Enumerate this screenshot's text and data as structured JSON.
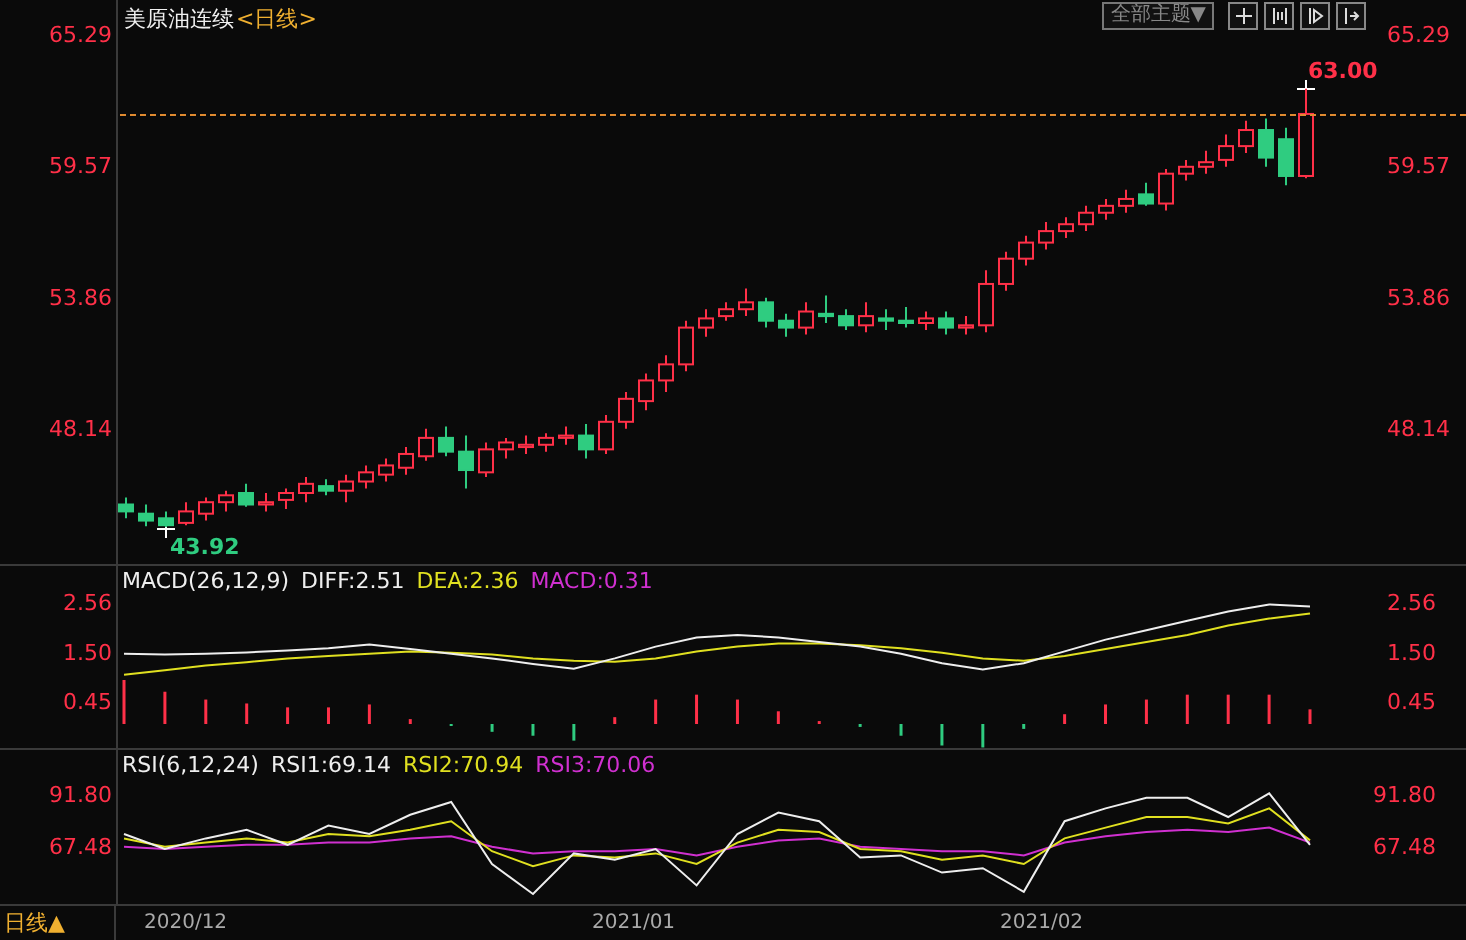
{
  "header": {
    "title": "美原油连续",
    "period_tag": "<日线>",
    "theme_button": "全部主题▼"
  },
  "price_panel": {
    "high_label": "63.00",
    "low_label": "43.92",
    "right_ticks": [
      "65.29",
      "59.57",
      "53.86",
      "48.14"
    ],
    "chart_data": {
      "type": "candlestick",
      "categories": [
        null,
        null,
        null,
        null,
        null,
        null,
        null,
        null,
        null,
        null,
        null,
        null,
        null,
        null,
        null,
        null,
        null,
        null,
        null,
        null,
        null,
        null,
        null,
        null,
        null,
        null,
        null,
        null,
        null,
        null,
        null,
        null,
        null,
        null,
        null,
        null,
        null,
        null,
        null,
        null,
        null,
        null,
        null,
        null,
        null,
        null,
        null,
        null,
        null,
        null,
        null,
        null,
        null,
        null,
        null,
        null,
        null,
        null,
        null,
        null
      ],
      "ylim": [
        42.31,
        66.86
      ],
      "yticks": [
        {
          "value": 65.29,
          "label": "65.29"
        },
        {
          "value": 59.57,
          "label": "59.57"
        },
        {
          "value": 53.86,
          "label": "53.86"
        },
        {
          "value": 48.14,
          "label": "48.14"
        }
      ],
      "ohlc": [
        [
          44.9,
          45.2,
          44.3,
          44.6
        ],
        [
          44.5,
          44.9,
          43.95,
          44.2
        ],
        [
          44.3,
          44.6,
          43.92,
          44.0
        ],
        [
          44.1,
          45.0,
          44.0,
          44.6
        ],
        [
          44.5,
          45.2,
          44.2,
          45.0
        ],
        [
          45.0,
          45.5,
          44.6,
          45.3
        ],
        [
          45.4,
          45.8,
          44.8,
          44.9
        ],
        [
          44.9,
          45.4,
          44.6,
          45.0
        ],
        [
          45.1,
          45.6,
          44.7,
          45.4
        ],
        [
          45.4,
          46.1,
          45.0,
          45.8
        ],
        [
          45.7,
          46.0,
          45.3,
          45.5
        ],
        [
          45.5,
          46.2,
          45.0,
          45.9
        ],
        [
          45.9,
          46.6,
          45.6,
          46.3
        ],
        [
          46.2,
          46.9,
          45.9,
          46.6
        ],
        [
          46.5,
          47.4,
          46.2,
          47.1
        ],
        [
          47.0,
          48.2,
          46.8,
          47.8
        ],
        [
          47.8,
          48.3,
          47.0,
          47.2
        ],
        [
          47.2,
          47.9,
          45.6,
          46.4
        ],
        [
          46.3,
          47.6,
          46.1,
          47.3
        ],
        [
          47.3,
          47.8,
          46.9,
          47.6
        ],
        [
          47.4,
          47.9,
          47.1,
          47.5
        ],
        [
          47.5,
          48.0,
          47.2,
          47.8
        ],
        [
          47.8,
          48.3,
          47.5,
          47.9
        ],
        [
          47.9,
          48.4,
          46.9,
          47.3
        ],
        [
          47.3,
          48.8,
          47.1,
          48.5
        ],
        [
          48.5,
          49.8,
          48.2,
          49.5
        ],
        [
          49.4,
          50.6,
          49.0,
          50.3
        ],
        [
          50.3,
          51.4,
          49.8,
          51.0
        ],
        [
          51.0,
          52.9,
          50.7,
          52.6
        ],
        [
          52.6,
          53.4,
          52.2,
          53.0
        ],
        [
          53.1,
          53.7,
          52.9,
          53.4
        ],
        [
          53.4,
          54.3,
          53.1,
          53.7
        ],
        [
          53.7,
          53.9,
          52.6,
          52.9
        ],
        [
          52.9,
          53.2,
          52.2,
          52.6
        ],
        [
          52.6,
          53.7,
          52.3,
          53.3
        ],
        [
          53.2,
          54.0,
          52.8,
          53.1
        ],
        [
          53.1,
          53.4,
          52.5,
          52.7
        ],
        [
          52.7,
          53.7,
          52.4,
          53.1
        ],
        [
          53.0,
          53.4,
          52.5,
          52.9
        ],
        [
          52.9,
          53.5,
          52.6,
          52.8
        ],
        [
          52.8,
          53.3,
          52.5,
          53.0
        ],
        [
          53.0,
          53.3,
          52.3,
          52.6
        ],
        [
          52.6,
          53.1,
          52.3,
          52.7
        ],
        [
          52.7,
          55.1,
          52.4,
          54.5
        ],
        [
          54.5,
          55.9,
          54.2,
          55.6
        ],
        [
          55.6,
          56.6,
          55.3,
          56.3
        ],
        [
          56.3,
          57.2,
          56.0,
          56.8
        ],
        [
          56.8,
          57.4,
          56.5,
          57.1
        ],
        [
          57.1,
          57.9,
          56.8,
          57.6
        ],
        [
          57.6,
          58.2,
          57.3,
          57.9
        ],
        [
          57.9,
          58.6,
          57.6,
          58.2
        ],
        [
          58.4,
          58.9,
          57.9,
          58.0
        ],
        [
          58.0,
          59.5,
          57.7,
          59.3
        ],
        [
          59.3,
          59.9,
          59.0,
          59.6
        ],
        [
          59.6,
          60.3,
          59.3,
          59.8
        ],
        [
          59.9,
          61.0,
          59.6,
          60.5
        ],
        [
          60.5,
          61.6,
          60.2,
          61.2
        ],
        [
          61.2,
          61.7,
          59.6,
          60.0
        ],
        [
          60.8,
          61.3,
          58.8,
          59.2
        ],
        [
          59.2,
          63.0,
          59.1,
          61.9
        ]
      ]
    }
  },
  "macd_panel": {
    "name": "MACD(26,12,9)",
    "right_ticks": [
      "2.56",
      "1.50",
      "0.45"
    ],
    "macd_value": "MACD:0.31",
    "lines": {
      "chart_data": {
        "type": "line",
        "ylim": [
          0.45,
          2.56
        ],
        "yticks": [
          {
            "value": 2.56,
            "label": "2.56"
          },
          {
            "value": 1.5,
            "label": "1.50"
          },
          {
            "value": 0.45,
            "label": "0.45"
          }
        ],
        "series": [
          {
            "name": "DIFF:2.51",
            "color": "#eeeeee",
            "values": [
              1.5,
              1.48,
              1.5,
              1.53,
              1.57,
              1.62,
              1.7,
              1.6,
              1.5,
              1.4,
              1.28,
              1.18,
              1.4,
              1.65,
              1.85,
              1.9,
              1.85,
              1.75,
              1.65,
              1.5,
              1.3,
              1.16,
              1.3,
              1.55,
              1.8,
              2.0,
              2.2,
              2.4,
              2.55,
              2.51
            ]
          },
          {
            "name": "DEA:2.36",
            "color": "#e0e020",
            "values": [
              1.05,
              1.15,
              1.25,
              1.32,
              1.4,
              1.45,
              1.5,
              1.55,
              1.52,
              1.48,
              1.4,
              1.35,
              1.33,
              1.4,
              1.55,
              1.65,
              1.72,
              1.72,
              1.68,
              1.62,
              1.52,
              1.4,
              1.35,
              1.45,
              1.6,
              1.75,
              1.9,
              2.1,
              2.25,
              2.36
            ]
          }
        ]
      }
    }
  },
  "rsi_panel": {
    "name": "RSI(6,12,24)",
    "right_ticks": [
      "91.80",
      "67.48"
    ],
    "chart_data": {
      "type": "line",
      "ylim": [
        41.29,
        113.32
      ],
      "yticks": [
        {
          "value": 91.8,
          "label": "91.80"
        },
        {
          "value": 67.48,
          "label": "67.48"
        }
      ],
      "series": [
        {
          "name": "RSI1:69.14",
          "color": "#eeeeee",
          "values": [
            74,
            67,
            72,
            76,
            69,
            78,
            74,
            83,
            89,
            60,
            46,
            65,
            62,
            67,
            50,
            74,
            84,
            80,
            63,
            64,
            56,
            58,
            47,
            80,
            86,
            91,
            91,
            82,
            93,
            69
          ]
        },
        {
          "name": "RSI2:70.94",
          "color": "#e0e020",
          "values": [
            72,
            68,
            70,
            72,
            70,
            74,
            73,
            76,
            80,
            66,
            59,
            64,
            63,
            65,
            60,
            70,
            76,
            75,
            67,
            66,
            62,
            64,
            60,
            72,
            77,
            82,
            82,
            79,
            86,
            71
          ]
        },
        {
          "name": "RSI3:70.06",
          "color": "#d030d0",
          "values": [
            68,
            67,
            68,
            69,
            69,
            70,
            70,
            72,
            73,
            68,
            65,
            66,
            66,
            67,
            64,
            68,
            71,
            72,
            68,
            67,
            66,
            66,
            64,
            70,
            73,
            75,
            76,
            75,
            77,
            70
          ]
        }
      ]
    }
  },
  "bottom_bar": {
    "period_button": "日线▲",
    "dates": [
      "2020/12",
      "2021/01",
      "2021/02"
    ]
  }
}
